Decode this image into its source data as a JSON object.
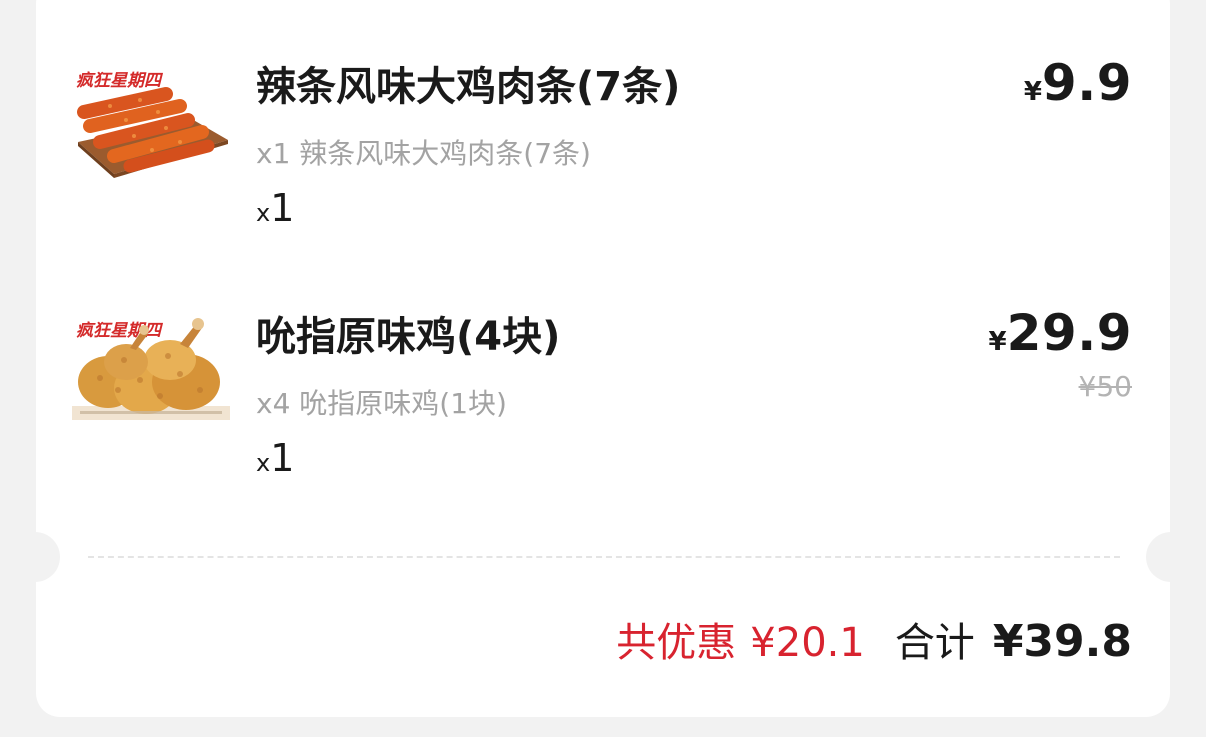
{
  "items": [
    {
      "badge": "疯狂星期四",
      "name": "辣条风味大鸡肉条(7条)",
      "currency": "¥",
      "price": "9.9",
      "detail": "x1 辣条风味大鸡肉条(7条)",
      "qty_prefix": "x",
      "qty": "1"
    },
    {
      "badge": "疯狂星期四",
      "name": "吮指原味鸡(4块)",
      "currency": "¥",
      "price": "29.9",
      "original_price": "¥50",
      "detail": "x4 吮指原味鸡(1块)",
      "qty_prefix": "x",
      "qty": "1"
    }
  ],
  "summary": {
    "discount_label": "共优惠",
    "discount_value": "¥20.1",
    "total_label": "合计",
    "total_value": "¥39.8"
  },
  "colors": {
    "accent_red": "#d8232f",
    "text_primary": "#1a1a1a",
    "text_secondary": "#a3a3a3"
  }
}
